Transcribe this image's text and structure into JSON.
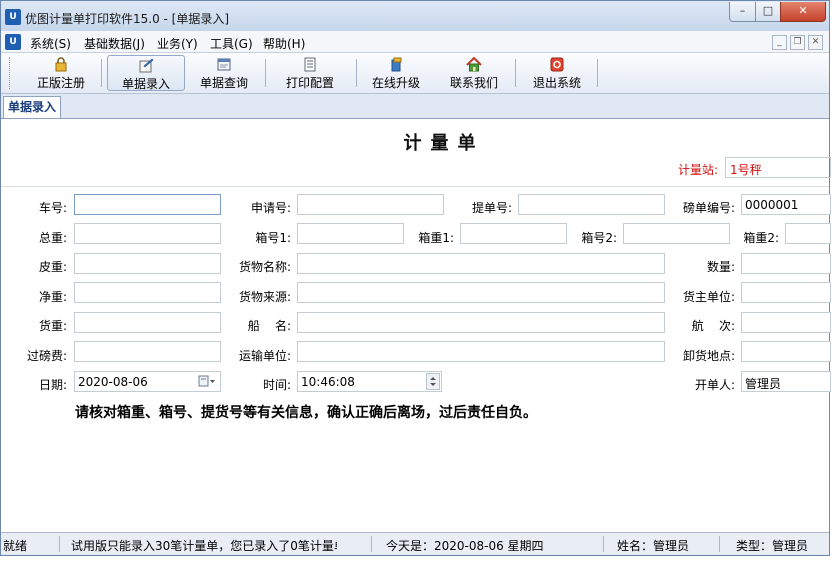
{
  "window": {
    "app_icon_text": "U",
    "title": "优图计量单打印软件15.0 - [单据录入]",
    "min_glyph": "–",
    "max_glyph": "□",
    "close_glyph": "✕"
  },
  "menu": {
    "icon_text": "U",
    "items": [
      "系统(S)",
      "基础数据(J)",
      "业务(Y)",
      "工具(G)",
      "帮助(H)"
    ],
    "mdi_min": "_",
    "mdi_restore": "❐",
    "mdi_close": "✕"
  },
  "toolbar": {
    "buttons": [
      {
        "label": "正版注册",
        "icon": "lock-icon"
      },
      {
        "label": "单据录入",
        "icon": "document-edit-icon"
      },
      {
        "label": "单据查询",
        "icon": "window-icon"
      },
      {
        "label": "打印配置",
        "icon": "list-icon"
      },
      {
        "label": "在线升级",
        "icon": "upgrade-icon"
      },
      {
        "label": "联系我们",
        "icon": "house-icon"
      },
      {
        "label": "退出系统",
        "icon": "exit-icon"
      }
    ]
  },
  "tab": {
    "label": "单据录入"
  },
  "form": {
    "title": "计量单",
    "station_label": "计量站:",
    "station_value": "1号秤",
    "fields": {
      "plate": {
        "label": "车号:",
        "value": ""
      },
      "apply_no": {
        "label": "申请号:",
        "value": ""
      },
      "bill_no": {
        "label": "提单号:",
        "value": ""
      },
      "weigh_no": {
        "label": "磅单编号:",
        "value": "0000001"
      },
      "gross": {
        "label": "总重:",
        "value": ""
      },
      "box_no1": {
        "label": "箱号1:",
        "value": ""
      },
      "box_weight1": {
        "label": "箱重1:",
        "value": ""
      },
      "box_no2": {
        "label": "箱号2:",
        "value": ""
      },
      "box_weight2": {
        "label": "箱重2:",
        "value": ""
      },
      "tare": {
        "label": "皮重:",
        "value": ""
      },
      "goods_name": {
        "label": "货物名称:",
        "value": ""
      },
      "quantity": {
        "label": "数量:",
        "value": ""
      },
      "net": {
        "label": "净重:",
        "value": ""
      },
      "goods_source": {
        "label": "货物来源:",
        "value": ""
      },
      "owner_unit": {
        "label": "货主单位:",
        "value": ""
      },
      "cargo_weight": {
        "label": "货重:",
        "value": ""
      },
      "ship_name": {
        "label": "船    名:",
        "value": ""
      },
      "voyage": {
        "label": "航    次:",
        "value": ""
      },
      "weigh_fee": {
        "label": "过磅费:",
        "value": ""
      },
      "transport_unit": {
        "label": "运输单位:",
        "value": ""
      },
      "unload_place": {
        "label": "卸货地点:",
        "value": ""
      },
      "date": {
        "label": "日期:",
        "value": "2020-08-06"
      },
      "time": {
        "label": "时间:",
        "value": "10:46:08"
      },
      "operator": {
        "label": "开单人:",
        "value": "管理员"
      }
    },
    "notice": "请核对箱重、箱号、提货号等有关信息，确认正确后离场，过后责任自负。"
  },
  "status": {
    "ready": "就绪",
    "trial": "试用版只能录入30笔计量单，您已录入了0笔计量单",
    "today": "今天是：2020-08-06 星期四",
    "name": "姓名：管理员",
    "type": "类型：管理员"
  }
}
